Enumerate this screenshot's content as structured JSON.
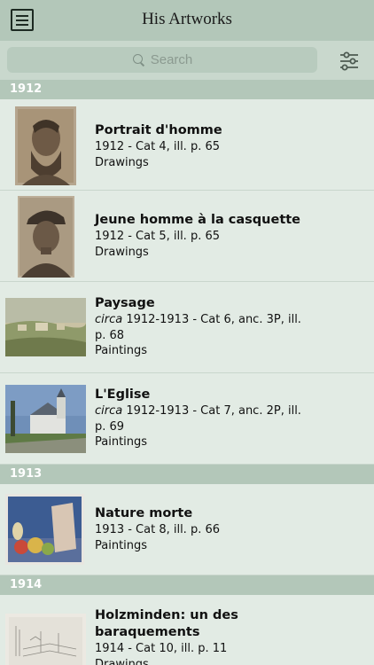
{
  "nav": {
    "title": "His Artworks",
    "menu_icon": "hamburger-menu-icon"
  },
  "search": {
    "placeholder": "Search",
    "icon": "search-icon",
    "filter_icon": "sliders-icon"
  },
  "sections": [
    {
      "year": "1912",
      "items": [
        {
          "title": "Portrait d'homme",
          "prefix": "",
          "details": "1912 - Cat 4, ill. p. 65",
          "category": "Drawings"
        },
        {
          "title": "Jeune homme à la casquette",
          "prefix": "",
          "details": "1912 - Cat 5, ill. p. 65",
          "category": "Drawings"
        },
        {
          "title": "Paysage",
          "prefix": "circa",
          "details": " 1912-1913 - Cat 6, anc. 3P, ill. p. 68",
          "category": "Paintings"
        },
        {
          "title": "L'Eglise",
          "prefix": "circa",
          "details": " 1912-1913 - Cat 7, anc. 2P, ill. p. 69",
          "category": "Paintings"
        }
      ]
    },
    {
      "year": "1913",
      "items": [
        {
          "title": "Nature morte",
          "prefix": "",
          "details": "1913 - Cat 8, ill. p. 66",
          "category": "Paintings"
        }
      ]
    },
    {
      "year": "1914",
      "items": [
        {
          "title": "Holzminden: un des baraquements",
          "prefix": "",
          "details": "1914 - Cat 10, ill. p. 11",
          "category": "Drawings"
        }
      ]
    }
  ]
}
